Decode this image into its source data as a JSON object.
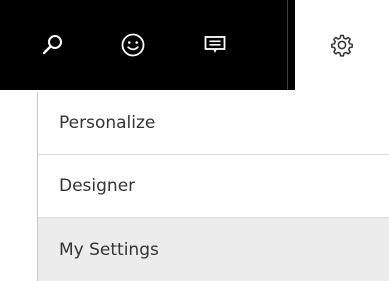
{
  "topbar": {
    "icons": {
      "search": "search-icon",
      "feedback": "smiley-icon",
      "chat": "chat-icon",
      "settings": "gear-icon"
    }
  },
  "menu": {
    "items": [
      {
        "label": "Personalize"
      },
      {
        "label": "Designer"
      },
      {
        "label": "My Settings",
        "highlighted": true
      }
    ]
  },
  "colors": {
    "topbar_bg": "#000000",
    "menu_highlight": "#ececec",
    "menu_text": "#333333"
  }
}
